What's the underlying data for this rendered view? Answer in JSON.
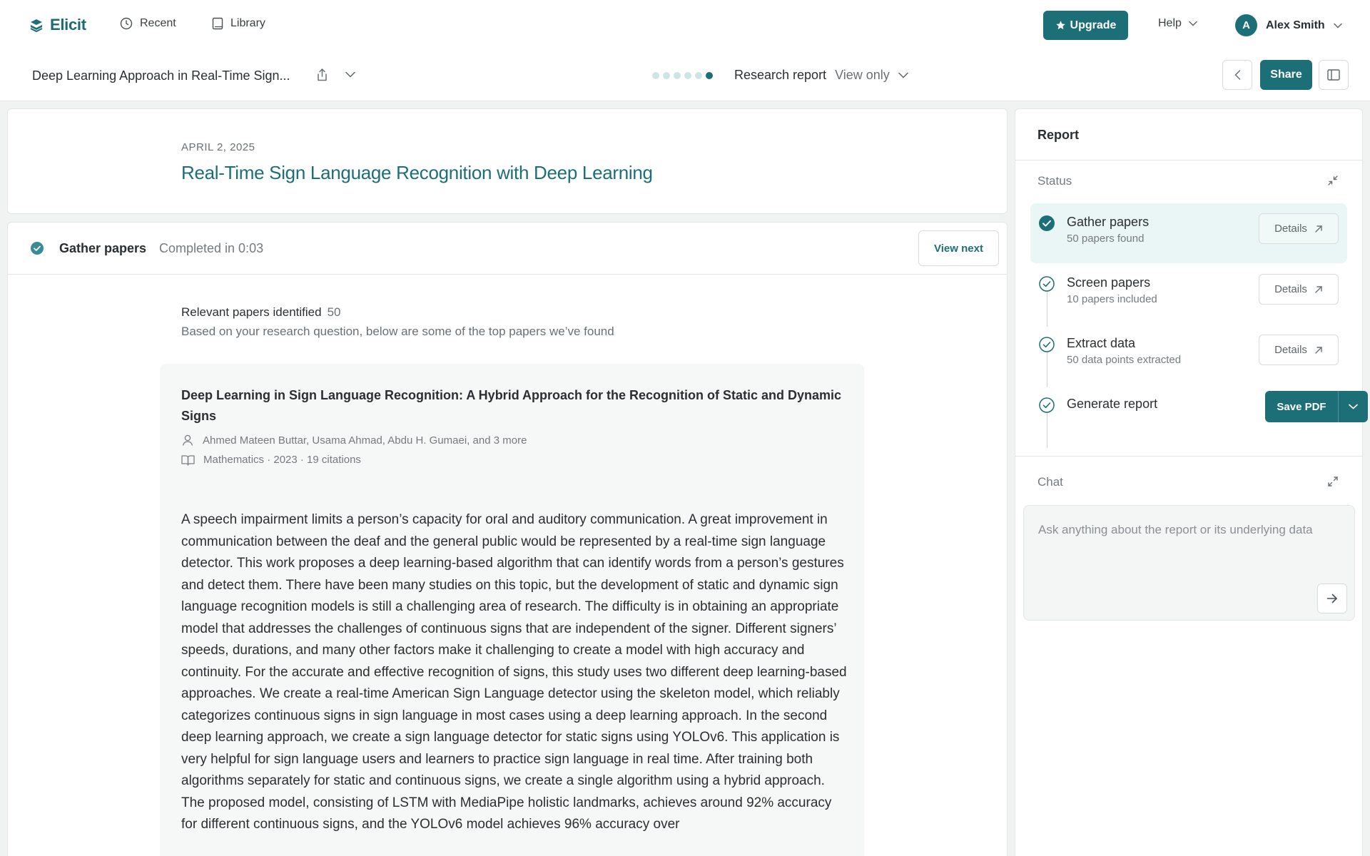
{
  "app": {
    "name": "Elicit",
    "accent": "#1d6f77"
  },
  "nav": {
    "recent": "Recent",
    "library": "Library",
    "upgrade": "Upgrade",
    "help": "Help",
    "user_initial": "A",
    "user_name": "Alex Smith"
  },
  "toolbar": {
    "doc_title": "Deep Learning Approach in Real-Time Sign...",
    "mode": "Research report",
    "permission": "View only",
    "share": "Share",
    "progress_dots": 6,
    "active_dot": 6
  },
  "report": {
    "date": "APRIL 2, 2025",
    "title": "Real-Time Sign Language Recognition with Deep Learning"
  },
  "step": {
    "name": "Gather papers",
    "time": "Completed in 0:03",
    "view_next": "View next"
  },
  "results": {
    "label": "Relevant papers identified",
    "count": "50",
    "subtitle": "Based on your research question, below are some of the top papers we’ve found"
  },
  "paper": {
    "title": "Deep Learning in Sign Language Recognition: A Hybrid Approach for the Recognition of Static and Dynamic Signs",
    "authors": "Ahmed Mateen Buttar, Usama Ahmad, Abdu H. Gumaei, and 3 more",
    "meta": "Mathematics · 2023 · 19 citations",
    "abstract": "A speech impairment limits a person’s capacity for oral and auditory communication. A great improvement in communication between the deaf and the general public would be represented by a real-time sign language detector. This work proposes a deep learning-based algorithm that can identify words from a person’s gestures and detect them. There have been many studies on this topic, but the development of static and dynamic sign language recognition models is still a challenging area of research. The difficulty is in obtaining an appropriate model that addresses the challenges of continuous signs that are independent of the signer. Different signers’ speeds, durations, and many other factors make it challenging to create a model with high accuracy and continuity. For the accurate and effective recognition of signs, this study uses two different deep learning-based approaches. We create a real-time American Sign Language detector using the skeleton model, which reliably categorizes continuous signs in sign language in most cases using a deep learning approach. In the second deep learning approach, we create a sign language detector for static signs using YOLOv6. This application is very helpful for sign language users and learners to practice sign language in real time. After training both algorithms separately for static and continuous signs, we create a single algorithm using a hybrid approach. The proposed model, consisting of LSTM with MediaPipe holistic landmarks, achieves around 92% accuracy for different continuous signs, and the YOLOv6 model achieves 96% accuracy over"
  },
  "side": {
    "title": "Report",
    "status_label": "Status",
    "tasks": [
      {
        "name": "Gather papers",
        "sub": "50 papers found",
        "details": "Details"
      },
      {
        "name": "Screen papers",
        "sub": "10 papers included",
        "details": "Details"
      },
      {
        "name": "Extract data",
        "sub": "50 data points extracted",
        "details": "Details"
      },
      {
        "name": "Generate report",
        "save_pdf": "Save PDF"
      }
    ],
    "chat_label": "Chat",
    "chat_placeholder": "Ask anything about the report or its underlying data"
  }
}
